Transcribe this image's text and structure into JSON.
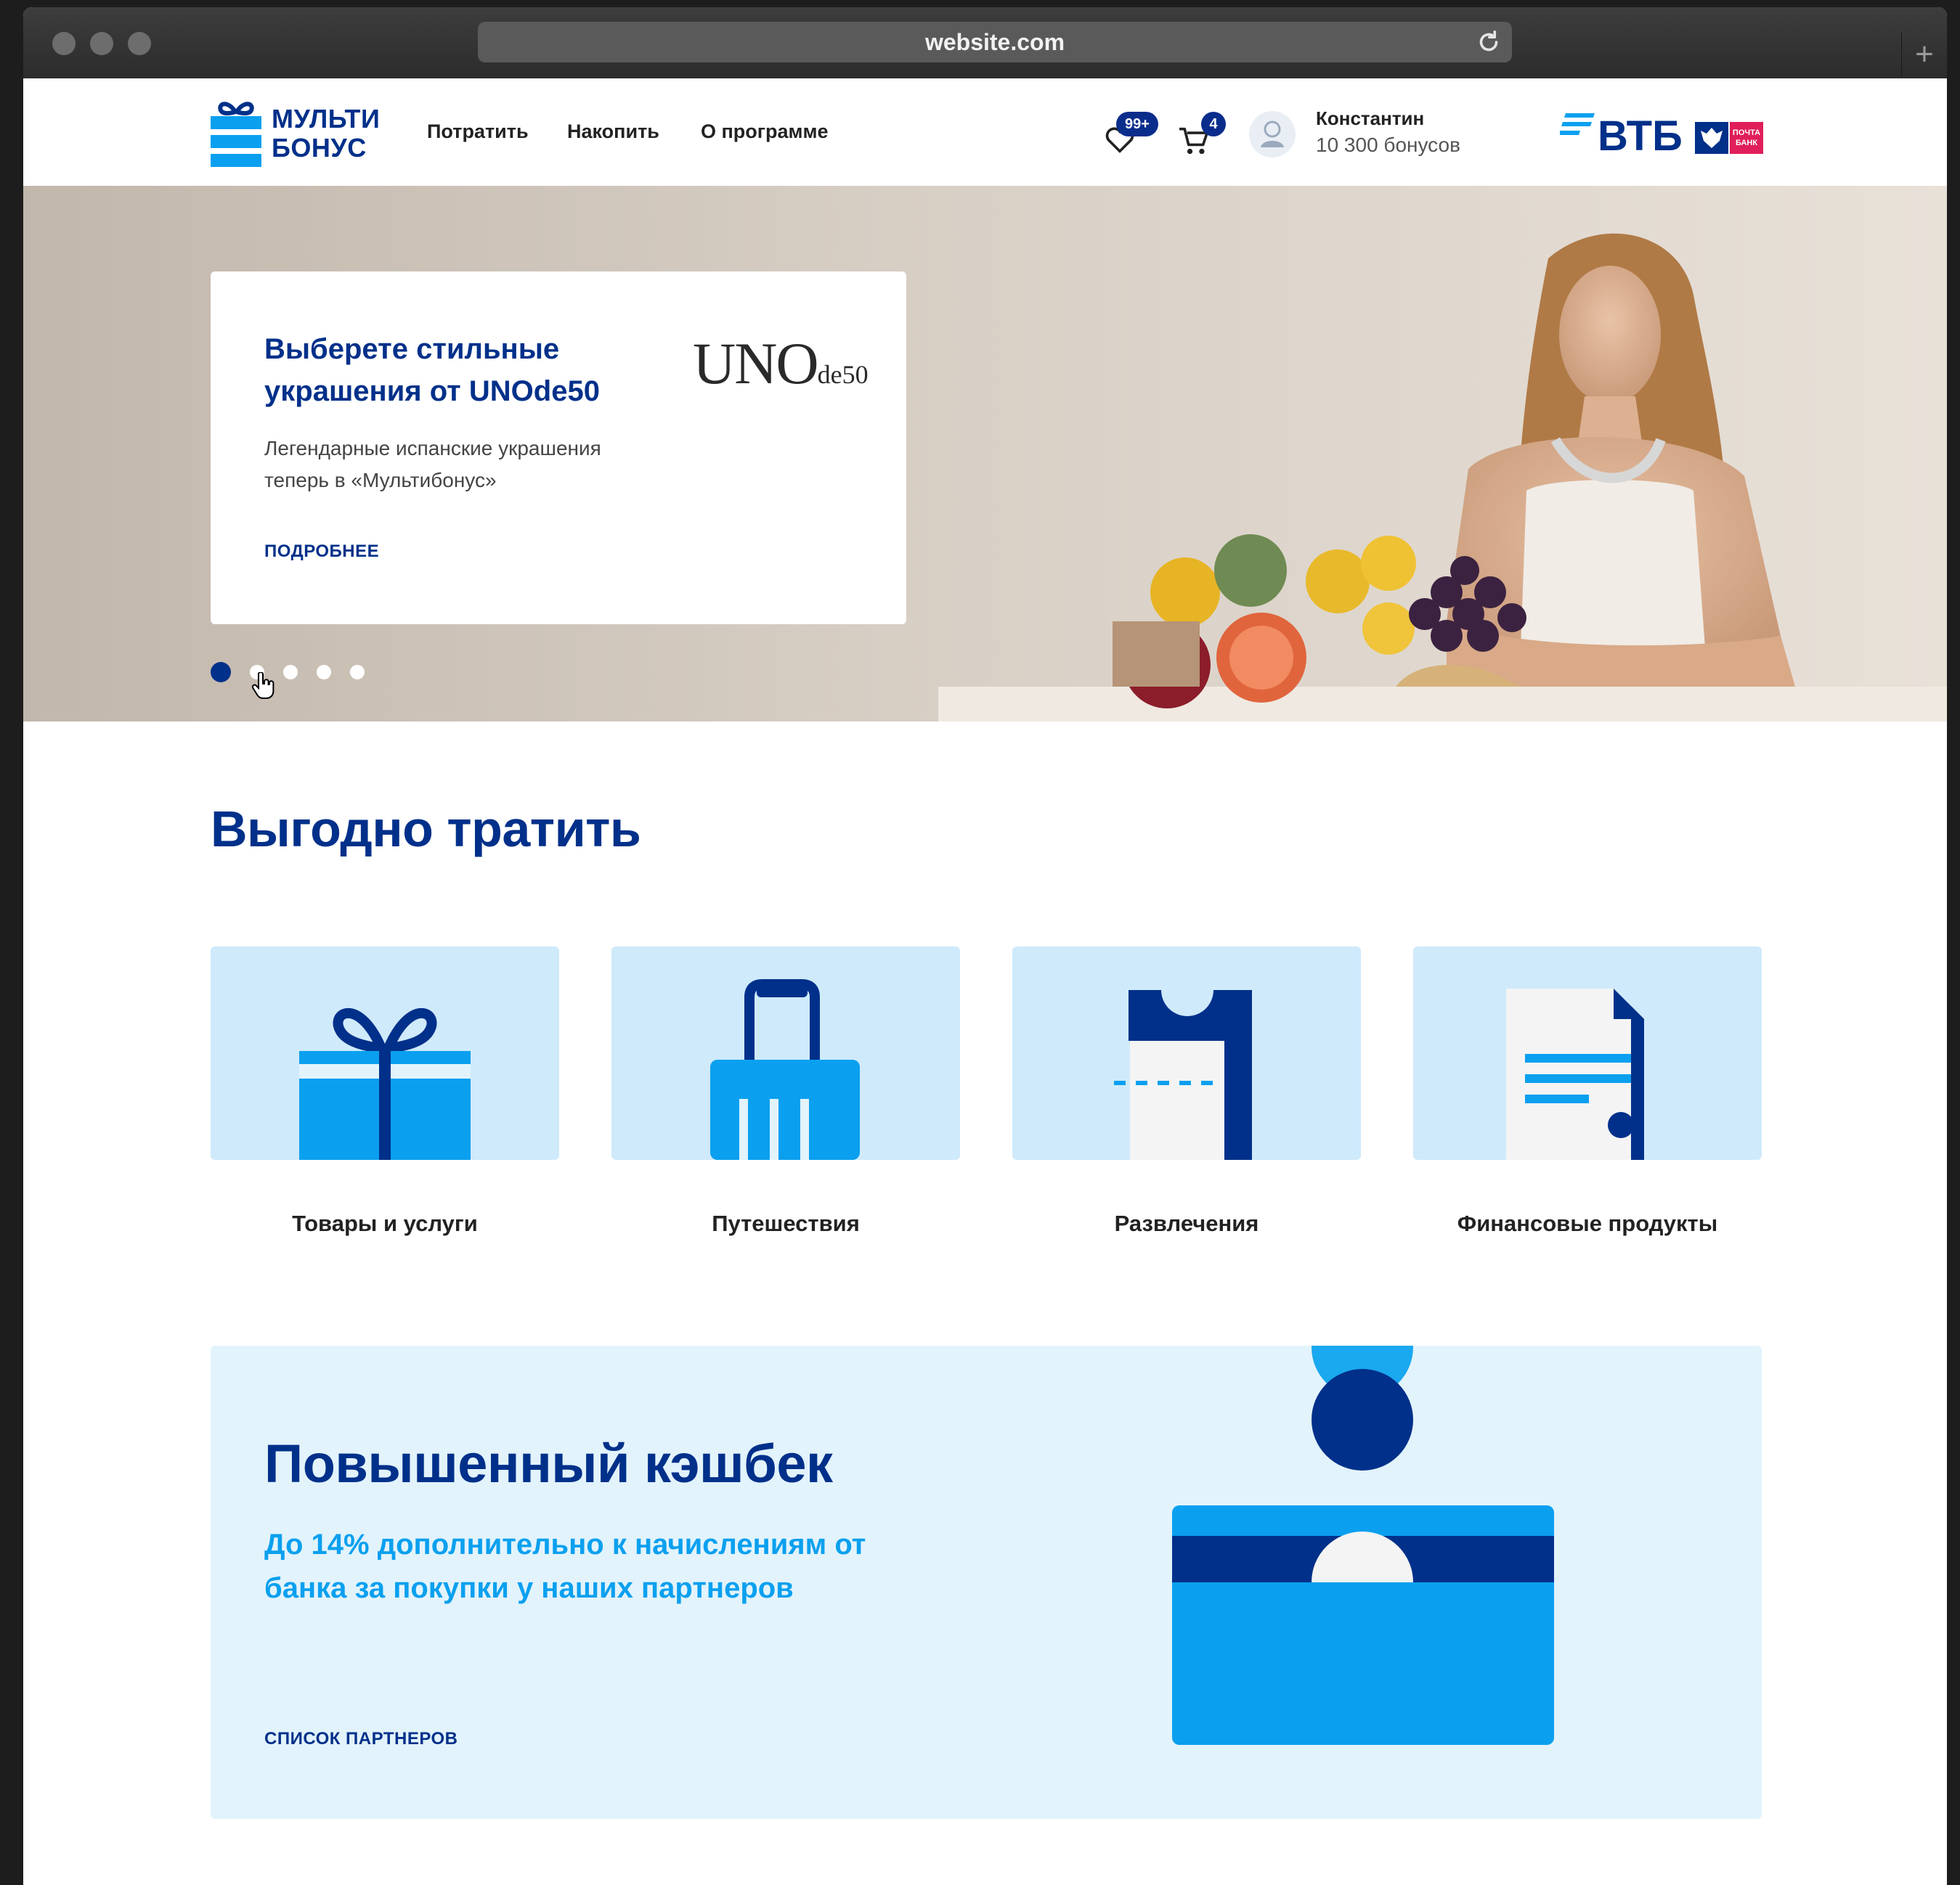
{
  "browser": {
    "url": "website.com"
  },
  "header": {
    "logo_line1": "МУЛЬТИ",
    "logo_line2": "БОНУС",
    "nav": [
      "Потратить",
      "Накопить",
      "О программе"
    ],
    "favorites_badge": "99+",
    "cart_badge": "4",
    "user_name": "Константин",
    "user_bonus": "10 300 бонусов",
    "bank_logo": "ВТБ",
    "partner_logo": "ПОЧТА БАНК"
  },
  "hero": {
    "title": "Выберете стильные украшения от UNOde50",
    "description": "Легендарные испанские украшения теперь в «Мультибонус»",
    "link": "ПОДРОБНЕЕ",
    "brand_main": "UNO",
    "brand_sub": "de50",
    "slides_total": 5,
    "active_slide": 1
  },
  "spend": {
    "title": "Выгодно тратить",
    "categories": [
      {
        "label": "Товары и услуги",
        "icon": "gift-icon"
      },
      {
        "label": "Путешествия",
        "icon": "suitcase-icon"
      },
      {
        "label": "Развлечения",
        "icon": "ticket-icon"
      },
      {
        "label": "Финансовые продукты",
        "icon": "document-icon"
      }
    ]
  },
  "cashback": {
    "title": "Повышенный кэшбек",
    "subtitle": "До 14% дополнительно к начислениям от банка за покупки у наших партнеров",
    "link": "СПИСОК ПАРТНЕРОВ"
  },
  "colors": {
    "brand_dark": "#00308a",
    "brand_light": "#0aa0ef",
    "tile_bg": "#cfeafb",
    "cashback_bg": "#e2f3fc"
  }
}
